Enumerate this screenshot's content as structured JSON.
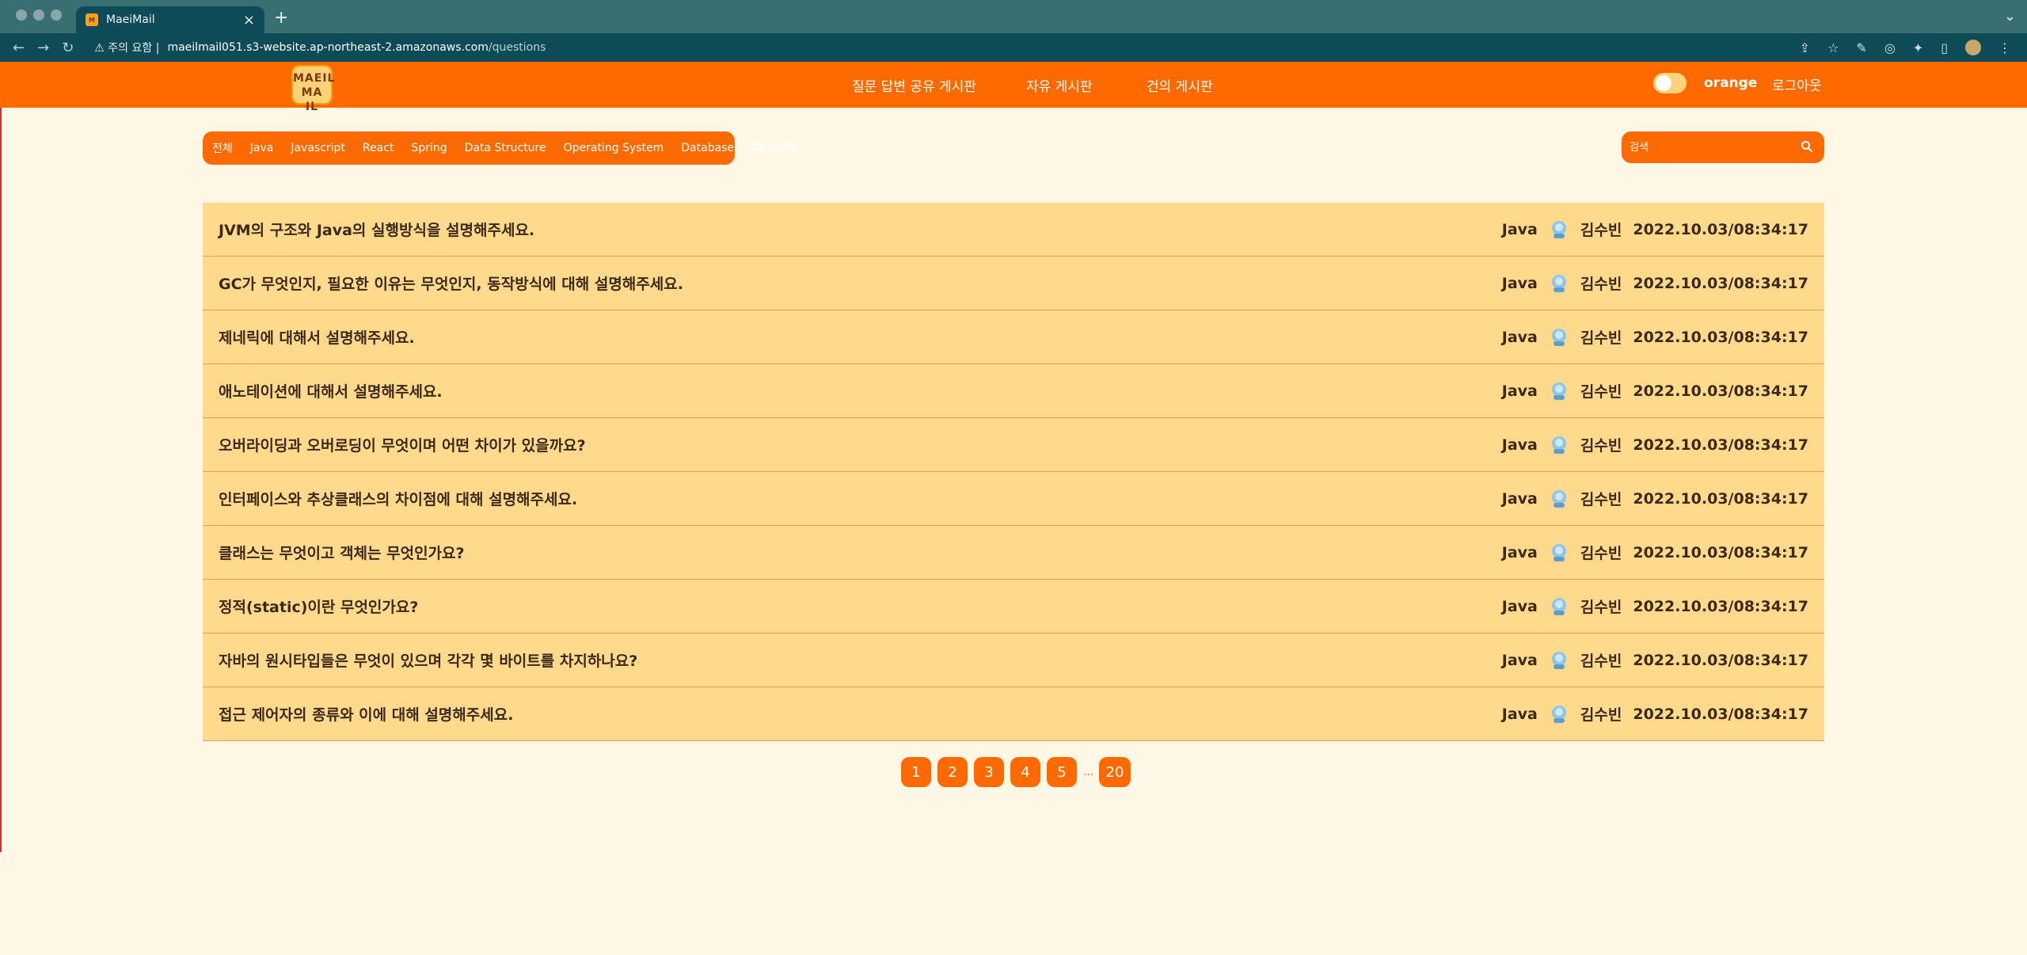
{
  "browser": {
    "tab_title": "MaeiMail",
    "tab_close": "×",
    "new_tab": "+",
    "security_label": "주의 요함",
    "url_host": "maeilmail051.s3-website.ap-northeast-2.amazonaws.com",
    "url_path": "/questions"
  },
  "header": {
    "logo_line1": "MAEIL",
    "logo_line2": "MA IL",
    "nav": [
      "질문 답변 공유 게시판",
      "자유 게시판",
      "건의 게시판"
    ],
    "theme_label": "orange",
    "logout": "로그아웃"
  },
  "categories": [
    "전체",
    "Java",
    "Javascript",
    "React",
    "Spring",
    "Data Structure",
    "Operating System",
    "Database",
    "Network"
  ],
  "search": {
    "placeholder": "검색"
  },
  "questions": [
    {
      "title": "JVM의 구조와 Java의 실행방식을 설명해주세요.",
      "category": "Java",
      "author": "김수빈",
      "date": "2022.10.03/08:34:17"
    },
    {
      "title": "GC가 무엇인지, 필요한 이유는 무엇인지, 동작방식에 대해 설명해주세요.",
      "category": "Java",
      "author": "김수빈",
      "date": "2022.10.03/08:34:17"
    },
    {
      "title": "제네릭에 대해서 설명해주세요.",
      "category": "Java",
      "author": "김수빈",
      "date": "2022.10.03/08:34:17"
    },
    {
      "title": "애노테이션에 대해서 설명해주세요.",
      "category": "Java",
      "author": "김수빈",
      "date": "2022.10.03/08:34:17"
    },
    {
      "title": "오버라이딩과 오버로딩이 무엇이며 어떤 차이가 있을까요?",
      "category": "Java",
      "author": "김수빈",
      "date": "2022.10.03/08:34:17"
    },
    {
      "title": "인터페이스와 추상클래스의 차이점에 대해 설명해주세요.",
      "category": "Java",
      "author": "김수빈",
      "date": "2022.10.03/08:34:17"
    },
    {
      "title": "클래스는 무엇이고 객체는 무엇인가요?",
      "category": "Java",
      "author": "김수빈",
      "date": "2022.10.03/08:34:17"
    },
    {
      "title": "정적(static)이란 무엇인가요?",
      "category": "Java",
      "author": "김수빈",
      "date": "2022.10.03/08:34:17"
    },
    {
      "title": "자바의 원시타입들은 무엇이 있으며 각각 몇 바이트를 차지하나요?",
      "category": "Java",
      "author": "김수빈",
      "date": "2022.10.03/08:34:17"
    },
    {
      "title": "접근 제어자의 종류와 이에 대해 설명해주세요.",
      "category": "Java",
      "author": "김수빈",
      "date": "2022.10.03/08:34:17"
    }
  ],
  "pagination": {
    "pages": [
      "1",
      "2",
      "3",
      "4",
      "5"
    ],
    "ellipsis": "...",
    "last": "20"
  },
  "colors": {
    "brand": "#ff6a00",
    "row": "#ffd98c",
    "background": "#fff8e6"
  }
}
